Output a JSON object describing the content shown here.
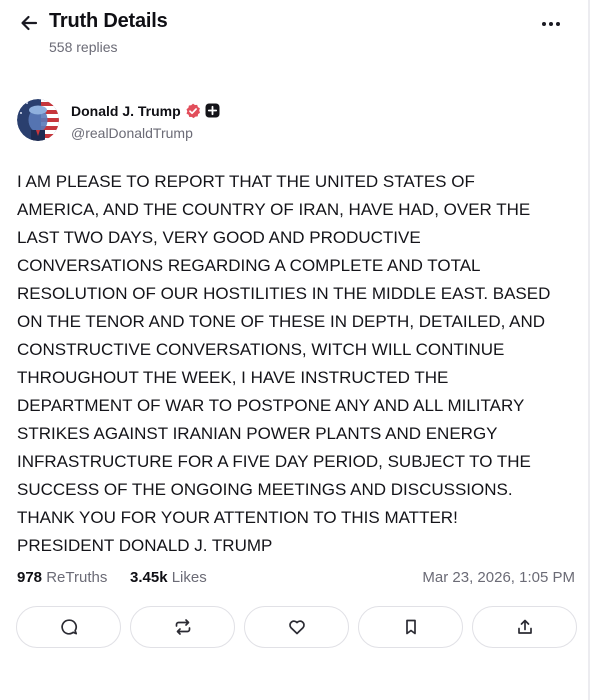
{
  "header": {
    "title": "Truth Details",
    "subtitle": "558 replies"
  },
  "author": {
    "name": "Donald J. Trump",
    "handle": "@realDonaldTrump"
  },
  "post": {
    "text": "I AM PLEASE TO REPORT THAT THE UNITED STATES OF\nAMERICA, AND THE COUNTRY OF IRAN, HAVE HAD, OVER THE\nLAST TWO DAYS, VERY GOOD AND PRODUCTIVE\nCONVERSATIONS REGARDING A COMPLETE AND TOTAL\nRESOLUTION OF OUR HOSTILITIES IN THE MIDDLE EAST. BASED\nON THE TENOR AND TONE OF THESE IN DEPTH, DETAILED, AND\nCONSTRUCTIVE CONVERSATIONS, WITCH WILL CONTINUE\nTHROUGHOUT THE WEEK, I HAVE INSTRUCTED THE\nDEPARTMENT OF WAR TO POSTPONE ANY AND ALL MILITARY\nSTRIKES AGAINST IRANIAN POWER PLANTS AND ENERGY\nINFRASTRUCTURE FOR A FIVE DAY PERIOD, SUBJECT TO THE\nSUCCESS OF THE ONGOING MEETINGS AND DISCUSSIONS.\nTHANK YOU FOR YOUR ATTENTION TO THIS MATTER!\nPRESIDENT DONALD J. TRUMP"
  },
  "stats": {
    "retruths_count": "978",
    "retruths_label": "ReTruths",
    "likes_count": "3.45k",
    "likes_label": "Likes",
    "timestamp": "Mar 23, 2026, 1:05 PM"
  },
  "icons": {
    "back": "arrow-left-icon",
    "more": "more-horizontal-icon",
    "verified": "verified-badge-icon",
    "plus": "plus-badge-icon",
    "reply": "comment-icon",
    "retruth": "repost-icon",
    "like": "heart-icon",
    "bookmark": "bookmark-icon",
    "share": "share-icon"
  },
  "colors": {
    "verified_badge": "#e24e5b",
    "text_primary": "#0f0f14",
    "text_secondary": "#6b6b76",
    "border": "#e1e1e6"
  }
}
